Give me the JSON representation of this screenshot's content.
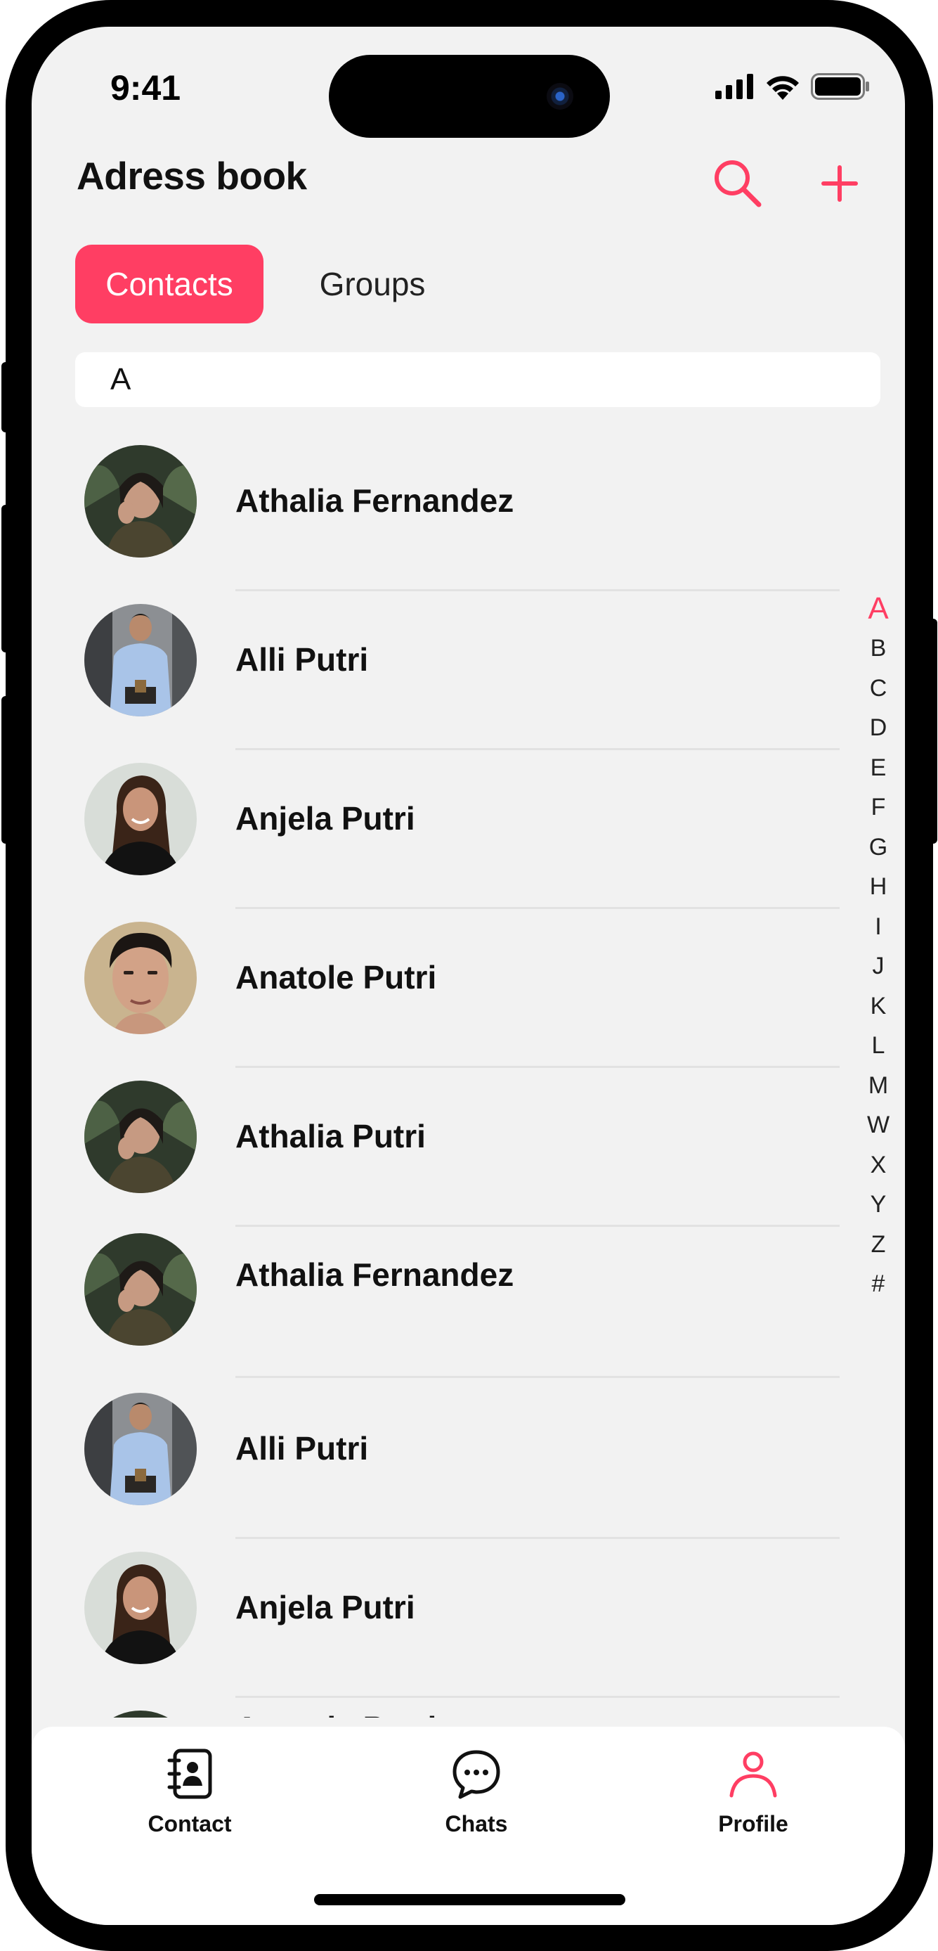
{
  "status_bar": {
    "time": "9:41"
  },
  "header": {
    "title": "Adress book",
    "search_icon": "search-icon",
    "add_icon": "plus-icon"
  },
  "tabs": [
    {
      "label": "Contacts",
      "active": true
    },
    {
      "label": "Groups",
      "active": false
    }
  ],
  "section_letter": "A",
  "contacts": [
    {
      "name": "Athalia Fernandez",
      "avatar": "woman-plants-avatar"
    },
    {
      "name": "Alli Putri",
      "avatar": "man-shirt-avatar"
    },
    {
      "name": "Anjela Putri",
      "avatar": "woman-smiling-avatar"
    },
    {
      "name": "Anatole Putri",
      "avatar": "man-portrait-avatar"
    },
    {
      "name": "Athalia Putri",
      "avatar": "woman-plants-avatar"
    },
    {
      "name": "Athalia Fernandez",
      "avatar": "woman-plants-avatar"
    },
    {
      "name": "Alli Putri",
      "avatar": "man-shirt-avatar"
    },
    {
      "name": "Anjela Putri",
      "avatar": "woman-smiling-avatar"
    },
    {
      "name": "Anatole Putri",
      "avatar": "woman-plants-avatar"
    }
  ],
  "alphabet_index": {
    "letters": [
      "A",
      "B",
      "C",
      "D",
      "E",
      "F",
      "G",
      "H",
      "I",
      "J",
      "K",
      "L",
      "M",
      "W",
      "X",
      "Y",
      "Z",
      "#"
    ],
    "active": "A"
  },
  "bottom_nav": [
    {
      "label": "Contact",
      "icon": "address-book-icon",
      "active": false
    },
    {
      "label": "Chats",
      "icon": "chat-bubble-icon",
      "active": false
    },
    {
      "label": "Profile",
      "icon": "person-icon",
      "active": true
    }
  ],
  "colors": {
    "accent": "#ff3e63",
    "background": "#f2f2f2",
    "text": "#111111"
  }
}
